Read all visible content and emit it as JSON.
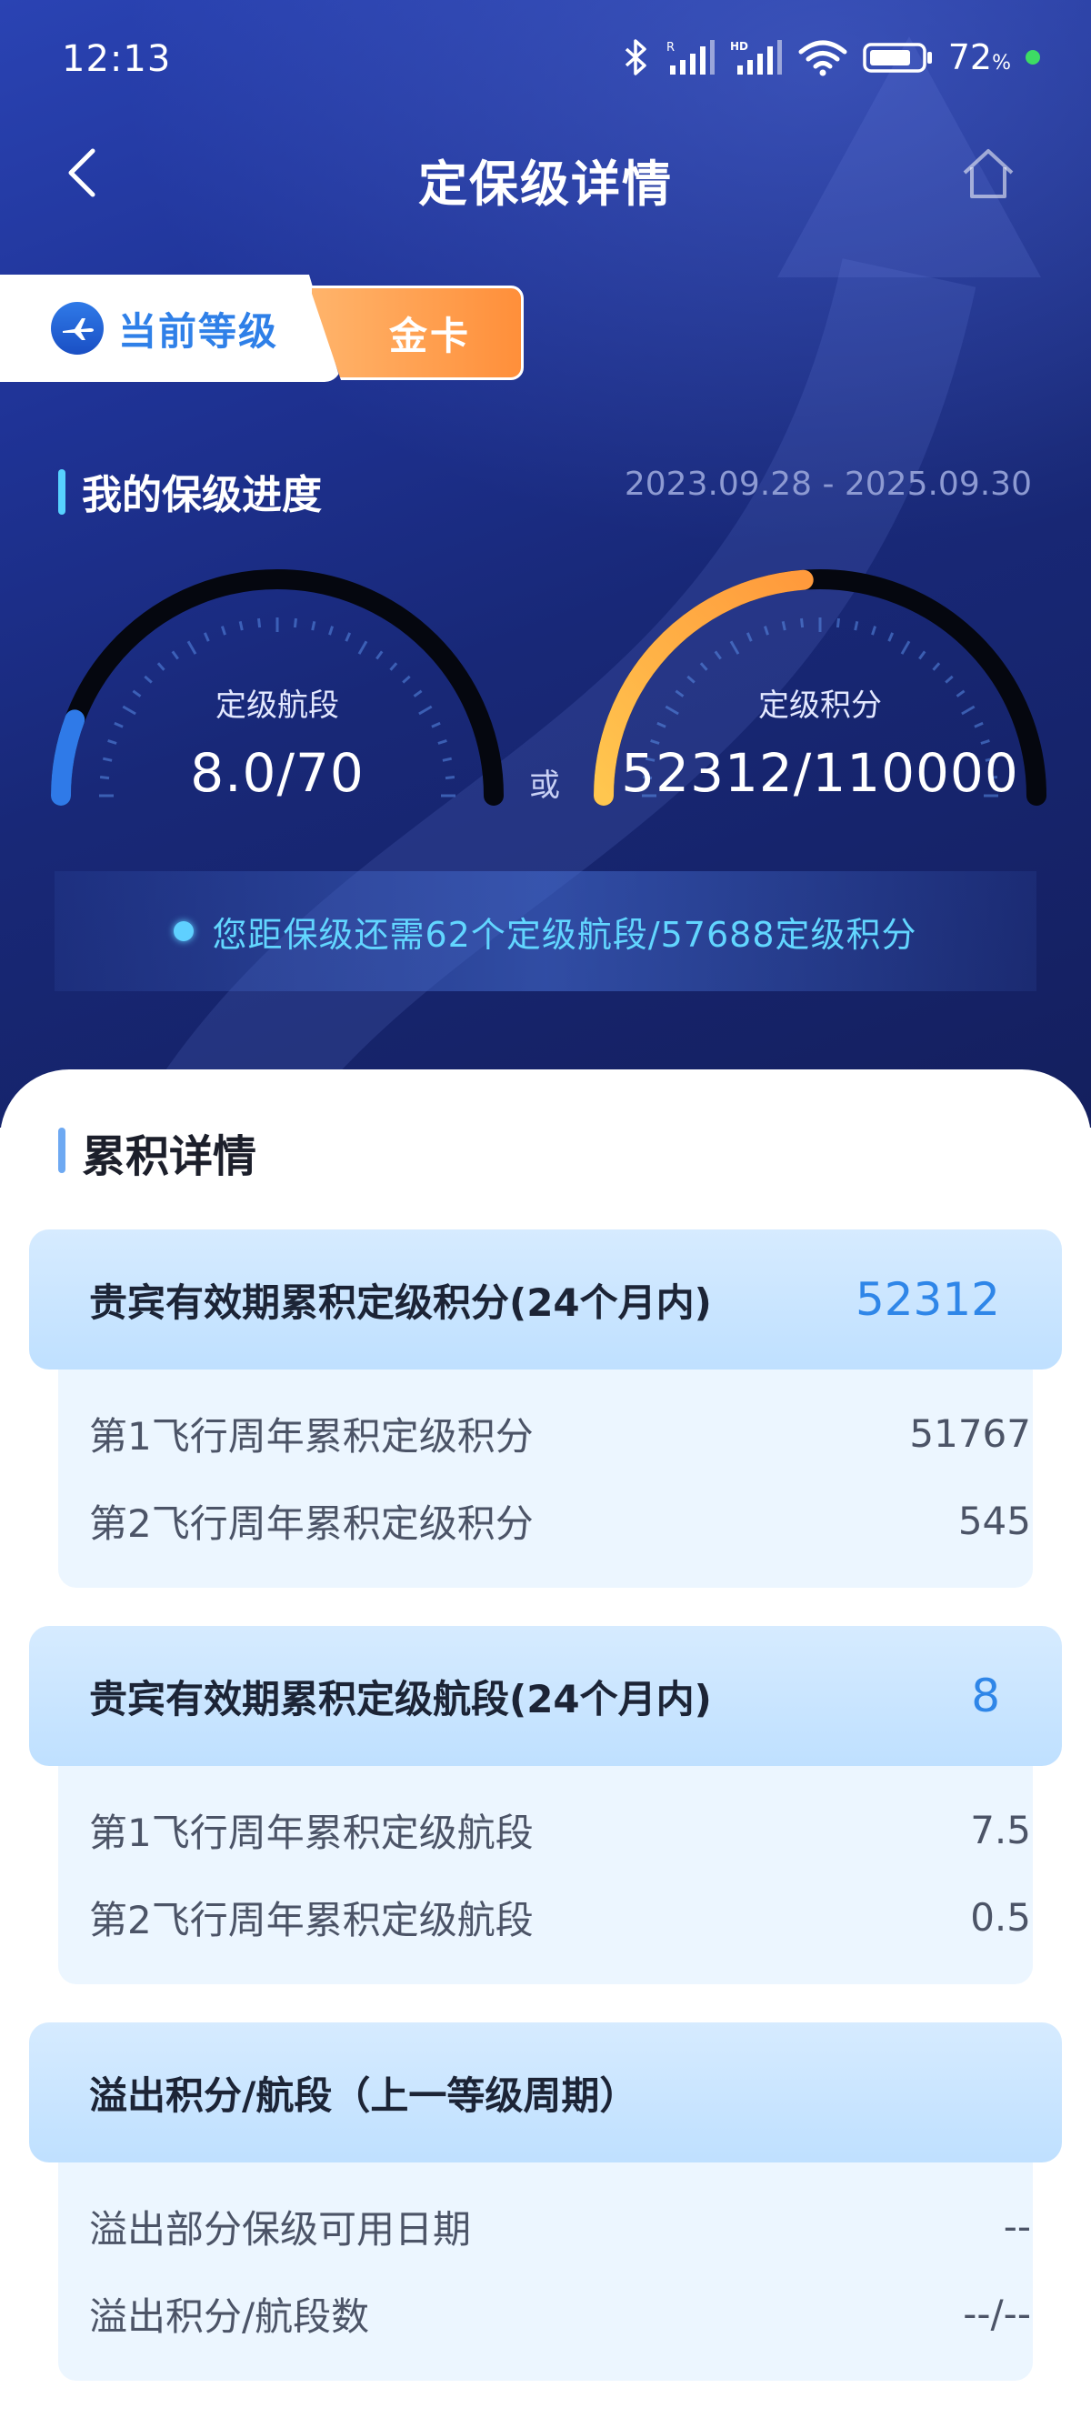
{
  "status_bar": {
    "time": "12:13",
    "battery_percent": "72",
    "battery_unit": "%",
    "icons": [
      "bluetooth-icon",
      "signal-r-icon",
      "signal-hd-icon",
      "wifi-icon",
      "battery-icon"
    ]
  },
  "nav": {
    "title": "定保级详情"
  },
  "level": {
    "label": "当前等级",
    "value": "金卡"
  },
  "progress": {
    "title": "我的保级进度",
    "period": "2023.09.28 - 2025.09.30",
    "segments": {
      "label": "定级航段",
      "value_text": "8.0/70",
      "current": 8.0,
      "target": 70,
      "color": "#2f7ae8"
    },
    "or_label": "或",
    "points": {
      "label": "定级积分",
      "value_text": "52312/110000",
      "current": 52312,
      "target": 110000,
      "color": "#ffb44a"
    },
    "notice": "您距保级还需62个定级航段/57688定级积分"
  },
  "details": {
    "title": "累积详情",
    "groups": [
      {
        "title": "贵宾有效期累积定级积分(24个月内)",
        "total": "52312",
        "rows": [
          {
            "label": "第1飞行周年累积定级积分",
            "value": "51767"
          },
          {
            "label": "第2飞行周年累积定级积分",
            "value": "545"
          }
        ]
      },
      {
        "title": "贵宾有效期累积定级航段(24个月内)",
        "total": "8",
        "rows": [
          {
            "label": "第1飞行周年累积定级航段",
            "value": "7.5"
          },
          {
            "label": "第2飞行周年累积定级航段",
            "value": "0.5"
          }
        ]
      },
      {
        "title": "溢出积分/航段（上一等级周期）",
        "total": "",
        "rows": [
          {
            "label": "溢出部分保级可用日期",
            "value": "--"
          },
          {
            "label": "溢出积分/航段数",
            "value": "--/--"
          }
        ]
      }
    ]
  },
  "colors": {
    "hero_bg": "#1f3396",
    "accent_blue": "#2f86e8",
    "accent_orange": "#ff8f3a",
    "notice_cyan": "#62d6ff"
  }
}
